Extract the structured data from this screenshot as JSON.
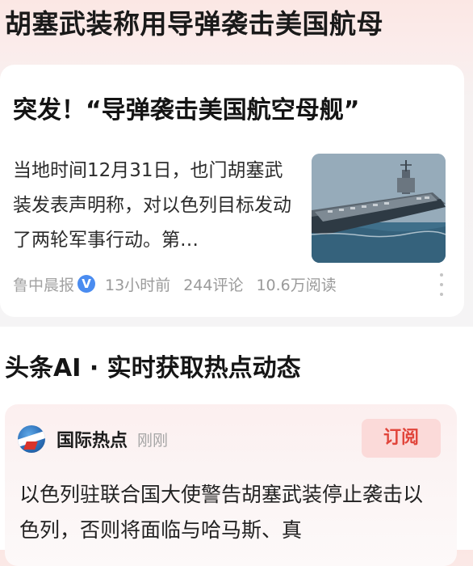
{
  "page_headline": "胡塞武装称用导弹袭击美国航母",
  "news_card": {
    "title": "突发！“导弹袭击美国航空母舰”",
    "summary": "当地时间12月31日，也门胡塞武装发表声明称，对以色列目标发动了两轮军事行动。第…",
    "image_icon": "aircraft-carrier-photo",
    "source": "鲁中晨报",
    "verified_icon": "verified-badge-icon",
    "time_ago": "13小时前",
    "comments": "244评论",
    "reads": "10.6万阅读",
    "more_icon": "more-vertical-icon"
  },
  "ai_section": {
    "title": "头条AI · 实时获取热点动态",
    "topic": {
      "logo_icon": "news-globe-logo",
      "name": "国际热点",
      "time": "刚刚",
      "subscribe_label": "订阅"
    },
    "body": "以色列驻联合国大使警告胡塞武装停止袭击以色列，否则将面临与哈马斯、真"
  },
  "colors": {
    "accent_red": "#e1453b",
    "subscribe_bg": "#fbdad9",
    "verified_blue": "#4a8cf0"
  }
}
